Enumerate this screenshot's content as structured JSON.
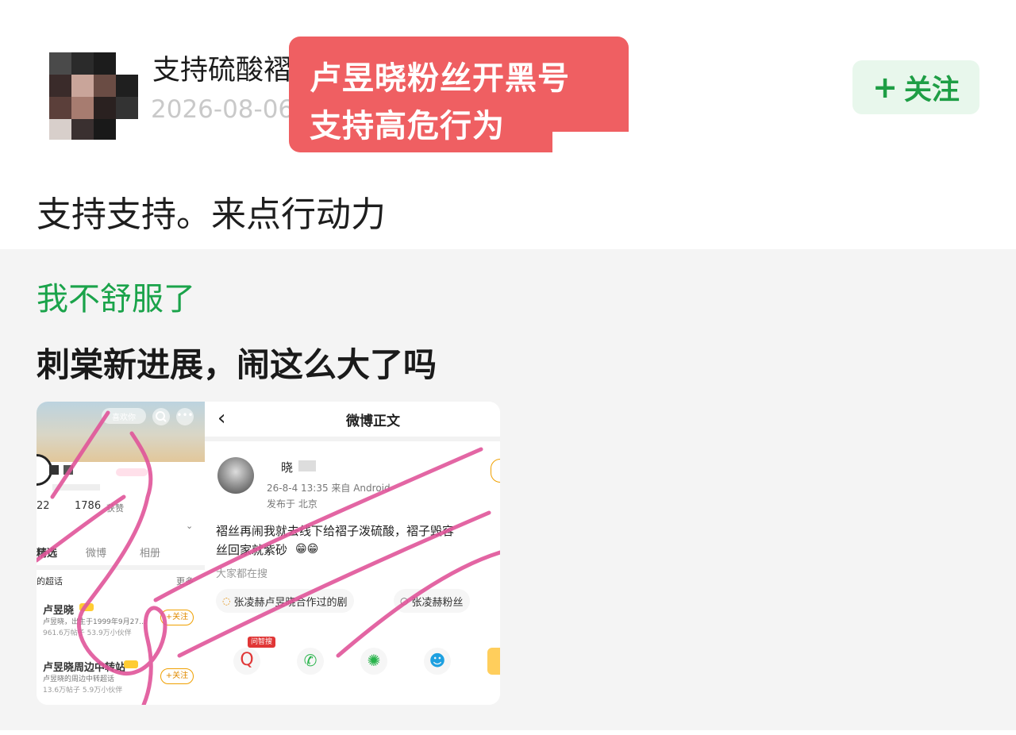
{
  "post": {
    "username": "支持硫酸褶子姐",
    "timestamp": "2026-08-06",
    "follow_label": "关注",
    "follow_icon": "plus-icon",
    "body_text": "支持支持。来点行动力"
  },
  "overlay": {
    "line1": "卢昱晓粉丝开黑号",
    "line2": "支持高危行为"
  },
  "repost": {
    "username": "我不舒服了",
    "text": "刺棠新进展，闹这么大了吗"
  },
  "screenshot": {
    "header_title": "微博正文",
    "back_icon": "chevron-left-icon",
    "left": {
      "pill": "喜欢你",
      "stat1": "22",
      "stat2": "1786",
      "stat2_suffix": "获赞",
      "tabs": [
        "精选",
        "微博",
        "相册"
      ],
      "section": "的超话",
      "more": "更多",
      "items": [
        {
          "name": "卢昱晓",
          "desc": "卢昱晓，出生于1999年9月27…",
          "stats": "961.6万帖子 53.9万小伙伴",
          "follow": "+关注"
        },
        {
          "name": "卢昱晓周边中转站",
          "desc": "卢昱晓的周边中转超话",
          "stats": "13.6万帖子 5.9万小伙伴",
          "follow": "+关注"
        }
      ]
    },
    "right": {
      "name": "晓",
      "meta": "26-8-4 13:35  来自 Android",
      "location": "发布于 北京",
      "content_line1": "褶丝再闹我就去线下给褶子泼硫酸，褶子毁容",
      "content_line2": "丝回家就紫砂",
      "search_section": "大家都在搜",
      "search_tags": [
        "张凌赫卢昱晓合作过的剧",
        "张凌赫粉丝"
      ],
      "badge": "问智搜",
      "share_icons": [
        "ai-search-icon",
        "wechat-icon",
        "moments-icon",
        "qq-icon"
      ]
    }
  },
  "colors": {
    "overlay": "#ef5f62",
    "green_user": "#1aa34a",
    "follow_bg": "#e8f7ec",
    "follow_text": "#1e9e45",
    "scribble": "#e0559a"
  }
}
